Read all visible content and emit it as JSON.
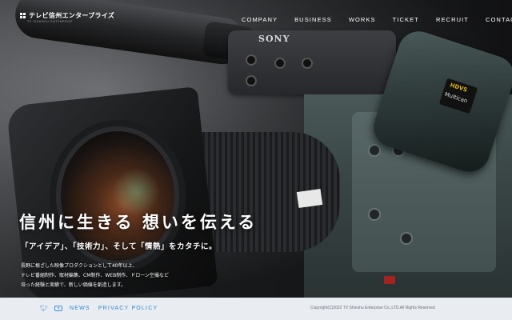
{
  "brand": {
    "name": "テレビ信州エンタープライズ",
    "sub": "TV SHINSHU ENTERPRISE"
  },
  "nav": {
    "items": [
      "COMPANY",
      "BUSINESS",
      "WORKS",
      "TICKET",
      "RECRUIT",
      "CONTACT"
    ]
  },
  "hero": {
    "headline": "信州に生きる 想いを伝える",
    "subline": "「アイデア」、「技術力」、そして「情熱」をカタチに。",
    "description": [
      "長野に根ざした映像プロダクションとして40年以上、",
      "テレビ番組制作、取材編集、CM制作、WEB制作、ドローン空撮など",
      "培った経験と実績で、新しい価値を創造します。"
    ],
    "camera_brand": "SONY",
    "badge_top": "HDVS",
    "badge_bottom": "Multican"
  },
  "footer": {
    "links": [
      "NEWS",
      "PRIVACY POLICY"
    ],
    "copyright": "Copyright(C)2022 TV Shinshu Enterprise Co.,LTD.All Rights Reserved",
    "social": [
      "twitter-icon",
      "youtube-icon"
    ]
  },
  "colors": {
    "accent": "#2e8bd0",
    "footer_bg": "#e9ecf1"
  }
}
